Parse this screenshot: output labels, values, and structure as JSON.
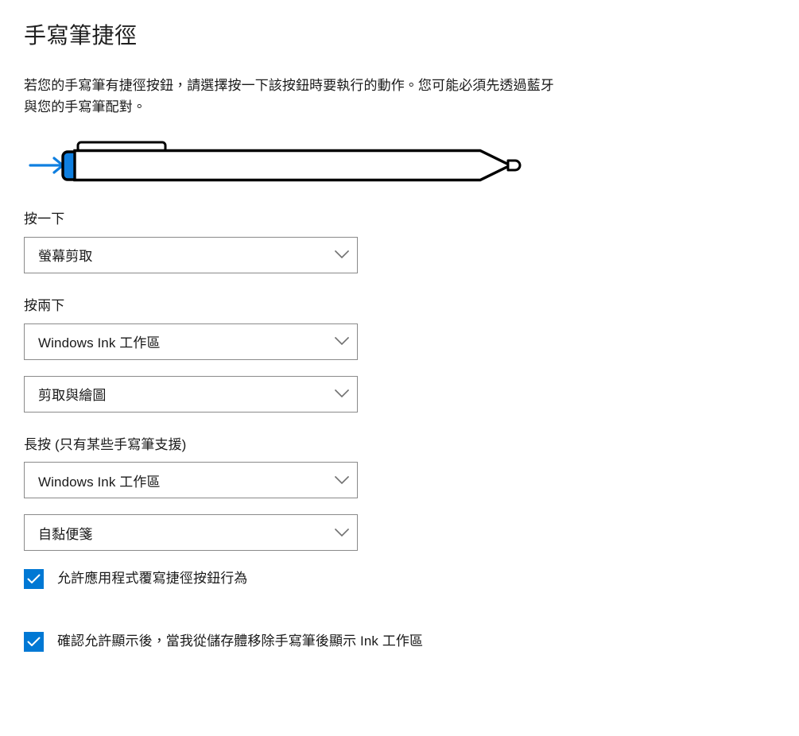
{
  "page": {
    "title": "手寫筆捷徑",
    "description": "若您的手寫筆有捷徑按鈕，請選擇按一下該按鈕時要執行的動作。您可能必須先透過藍牙與您的手寫筆配對。"
  },
  "illustration": {
    "name": "stylus-pen-diagram",
    "arrow_label": "→",
    "button_color": "#0f7fe0",
    "outline_color": "#000000",
    "body_color": "#ffffff"
  },
  "groups": [
    {
      "label": "按一下",
      "dropdowns": [
        {
          "value": "螢幕剪取"
        }
      ]
    },
    {
      "label": "按兩下",
      "dropdowns": [
        {
          "value": "Windows Ink 工作區"
        },
        {
          "value": "剪取與繪圖"
        }
      ]
    },
    {
      "label": "長按 (只有某些手寫筆支援)",
      "dropdowns": [
        {
          "value": "Windows Ink 工作區"
        },
        {
          "value": "自黏便箋"
        }
      ]
    }
  ],
  "checkboxes": [
    {
      "label": "允許應用程式覆寫捷徑按鈕行為",
      "checked": true
    },
    {
      "label": "確認允許顯示後，當我從儲存體移除手寫筆後顯示 Ink 工作區",
      "checked": true
    }
  ],
  "colors": {
    "accent": "#0078d4",
    "text": "#1a1a1a",
    "border": "#8a8a8a",
    "chevron": "#707070",
    "background": "#ffffff"
  },
  "icons": {
    "chevron_down": "chevron-down-icon",
    "checkmark": "checkmark-icon",
    "arrow_right": "arrow-right-icon"
  }
}
